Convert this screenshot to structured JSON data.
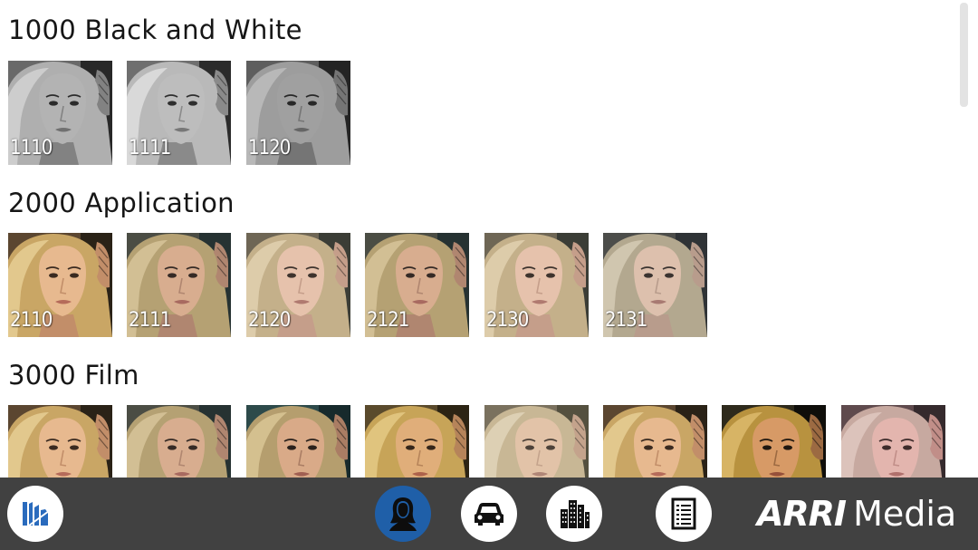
{
  "sections": [
    {
      "title": "1000 Black and White",
      "thumbnails": [
        {
          "label": "1110",
          "tint": "bw",
          "dark": 0.05
        },
        {
          "label": "1111",
          "tint": "bw",
          "dark": 0.0
        },
        {
          "label": "1120",
          "tint": "bw",
          "dark": 0.15
        }
      ]
    },
    {
      "title": "2000 Application",
      "thumbnails": [
        {
          "label": "2110",
          "tint": "warm"
        },
        {
          "label": "2111",
          "tint": "neutral"
        },
        {
          "label": "2120",
          "tint": "pale"
        },
        {
          "label": "2121",
          "tint": "neutral"
        },
        {
          "label": "2130",
          "tint": "pale"
        },
        {
          "label": "2131",
          "tint": "cool"
        }
      ]
    },
    {
      "title": "3000 Film",
      "thumbnails": [
        {
          "label": "",
          "tint": "warm"
        },
        {
          "label": "",
          "tint": "neutral"
        },
        {
          "label": "",
          "tint": "teal"
        },
        {
          "label": "",
          "tint": "gold"
        },
        {
          "label": "",
          "tint": "faded"
        },
        {
          "label": "",
          "tint": "warm"
        },
        {
          "label": "",
          "tint": "contrast"
        },
        {
          "label": "",
          "tint": "rose"
        }
      ]
    }
  ],
  "bottom_bar": {
    "brand_bold": "ARRI",
    "brand_light": "Media",
    "buttons": [
      {
        "icon": "app-logo-icon",
        "active": false
      },
      {
        "icon": "portrait-icon",
        "active": true
      },
      {
        "icon": "car-icon",
        "active": false
      },
      {
        "icon": "city-icon",
        "active": false
      },
      {
        "icon": "document-list-icon",
        "active": false
      }
    ]
  },
  "colors": {
    "bar_bg": "#414141",
    "active_button": "#1f5fa8",
    "scrollbar_thumb": "#e3e3e3"
  }
}
